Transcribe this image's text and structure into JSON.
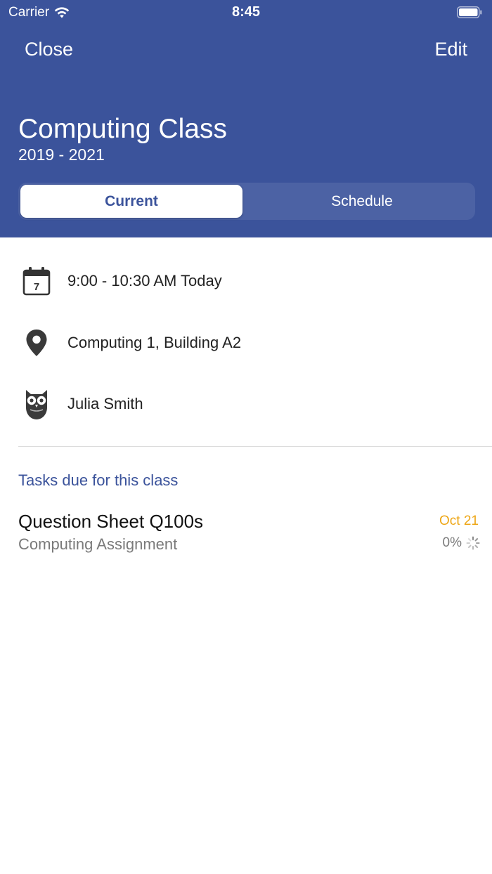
{
  "status_bar": {
    "carrier": "Carrier",
    "time": "8:45"
  },
  "nav": {
    "close_label": "Close",
    "edit_label": "Edit"
  },
  "class": {
    "title": "Computing Class",
    "years": "2019 - 2021"
  },
  "segments": {
    "current_label": "Current",
    "schedule_label": "Schedule",
    "selected": "Current"
  },
  "info": {
    "time_text": "9:00 - 10:30 AM Today",
    "calendar_day": "7",
    "location_text": "Computing 1, Building A2",
    "teacher_text": "Julia Smith"
  },
  "tasks": {
    "heading": "Tasks due for this class",
    "items": [
      {
        "title": "Question Sheet Q100s",
        "subtitle": "Computing Assignment",
        "due": "Oct 21",
        "progress": "0%"
      }
    ]
  },
  "colors": {
    "brand": "#3b539b",
    "due_accent": "#eea615"
  },
  "icons": {
    "calendar": "calendar-icon",
    "location": "location-pin-icon",
    "teacher": "owl-icon",
    "progress": "spinner-icon",
    "wifi": "wifi-icon",
    "battery": "battery-icon"
  }
}
